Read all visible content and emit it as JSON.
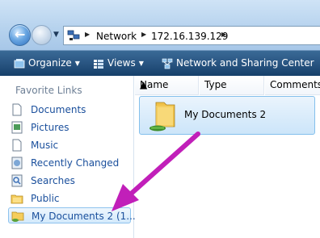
{
  "address": {
    "crumbs": [
      "Network",
      "172.16.139.129"
    ]
  },
  "toolbar": {
    "organize": "Organize",
    "views": "Views",
    "network_center": "Network and Sharing Center"
  },
  "sidebar": {
    "heading": "Favorite Links",
    "items": [
      {
        "label": "Documents"
      },
      {
        "label": "Pictures"
      },
      {
        "label": "Music"
      },
      {
        "label": "Recently Changed"
      },
      {
        "label": "Searches"
      },
      {
        "label": "Public"
      },
      {
        "label": "My Documents 2 (1..."
      }
    ]
  },
  "columns": [
    "Name",
    "Type",
    "Comments"
  ],
  "files": [
    {
      "name": "My Documents 2"
    }
  ],
  "colors": {
    "toolbar": "#2b5784",
    "selection": "#cce5f9",
    "annotation_arrow": "#c11fb9"
  }
}
